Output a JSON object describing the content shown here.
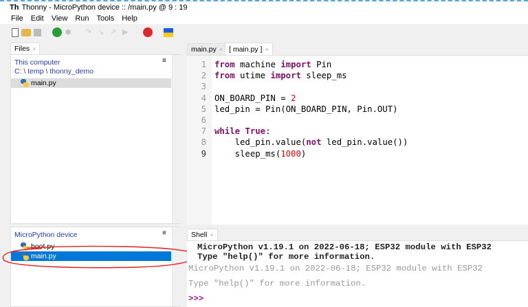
{
  "window": {
    "title": "Thonny  -  MicroPython device :: /main.py  @  9 : 19"
  },
  "menu": [
    "File",
    "Edit",
    "View",
    "Run",
    "Tools",
    "Help"
  ],
  "toolbar": [
    "new-file-icon",
    "open-file-icon",
    "save-icon",
    "run-icon",
    "debug-icon",
    "step-over-icon",
    "step-into-icon",
    "step-out-icon",
    "resume-icon",
    "stop-icon",
    "ukraine-flag-icon"
  ],
  "files": {
    "tab_label": "Files",
    "this_computer": {
      "title": "This computer",
      "path": "C: \\ temp \\ thonny_demo",
      "items": [
        "main.py"
      ]
    },
    "device": {
      "title": "MicroPython device",
      "items": [
        "boot.py",
        "main.py"
      ],
      "selected": "main.py"
    },
    "menu_glyph": "≡"
  },
  "editor": {
    "tabs": [
      {
        "label": "main.py"
      },
      {
        "label": "[ main.py ]"
      }
    ],
    "lines": [
      [
        {
          "t": "from",
          "k": "kw"
        },
        {
          "t": " machine "
        },
        {
          "t": "import",
          "k": "kw"
        },
        {
          "t": " Pin"
        }
      ],
      [
        {
          "t": "from",
          "k": "kw"
        },
        {
          "t": " utime "
        },
        {
          "t": "import",
          "k": "kw"
        },
        {
          "t": " sleep_ms"
        }
      ],
      [],
      [
        {
          "t": "ON_BOARD_PIN = "
        },
        {
          "t": "2",
          "k": "num"
        }
      ],
      [
        {
          "t": "led_pin = Pin(ON_BOARD_PIN, Pin.OUT)"
        }
      ],
      [],
      [
        {
          "t": "while",
          "k": "kw"
        },
        {
          "t": " "
        },
        {
          "t": "True",
          "k": "kw"
        },
        {
          "t": ":"
        }
      ],
      [
        {
          "t": "    led_pin.value("
        },
        {
          "t": "not",
          "k": "kw"
        },
        {
          "t": " led_pin.value())"
        }
      ],
      [
        {
          "t": "    sleep_ms("
        },
        {
          "t": "1000",
          "k": "num"
        },
        {
          "t": ")"
        }
      ]
    ]
  },
  "shell": {
    "tab_label": "Shell",
    "lines_bold": [
      "MicroPython v1.19.1 on 2022-06-18; ESP32 module with ESP32",
      "Type \"help()\" for more information."
    ],
    "lines_gray": [
      "MicroPython v1.19.1 on 2022-06-18; ESP32 module with ESP32",
      "Type \"help()\" for more information."
    ],
    "prompt": ">>>"
  },
  "colors": {
    "selection": "#0078d7",
    "annotation": "#e02020",
    "keyword": "#7f0f67"
  }
}
